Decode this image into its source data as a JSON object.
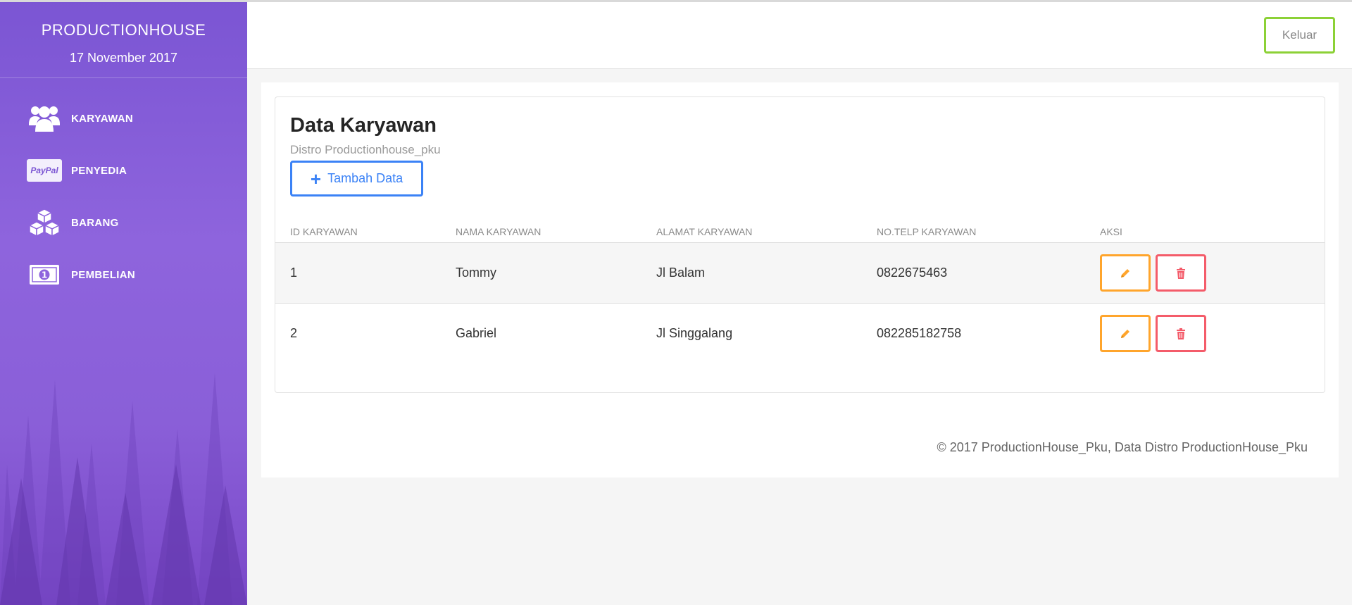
{
  "sidebar": {
    "brand_name": "PRODUCTIONHOUSE",
    "date": "17 November 2017",
    "items": [
      {
        "label": "KARYAWAN",
        "icon": "users-icon"
      },
      {
        "label": "PENYEDIA",
        "icon": "paypal-icon",
        "badge_text": "PayPal"
      },
      {
        "label": "BARANG",
        "icon": "boxes-icon"
      },
      {
        "label": "PEMBELIAN",
        "icon": "money-icon"
      }
    ],
    "colors": {
      "gradient_top": "#7b55d3",
      "gradient_bottom": "#7a48c8"
    }
  },
  "header": {
    "logout_label": "Keluar",
    "logout_color": "#8cd136"
  },
  "main": {
    "title": "Data Karyawan",
    "subtitle": "Distro Productionhouse_pku",
    "add_button_label": "Tambah Data",
    "add_button_icon": "plus-icon",
    "table": {
      "columns": [
        "ID KARYAWAN",
        "NAMA KARYAWAN",
        "ALAMAT KARYAWAN",
        "NO.TELP KARYAWAN",
        "AKSI"
      ],
      "rows": [
        {
          "id": "1",
          "name": "Tommy",
          "address": "Jl Balam",
          "phone": "0822675463"
        },
        {
          "id": "2",
          "name": "Gabriel",
          "address": "Jl Singgalang",
          "phone": "082285182758"
        }
      ],
      "actions": [
        {
          "name": "edit",
          "icon": "pencil-icon",
          "color": "#ffa52c"
        },
        {
          "name": "delete",
          "icon": "trash-icon",
          "color": "#f45c6a"
        }
      ]
    },
    "footer": "© 2017 ProductionHouse_Pku, Data Distro ProductionHouse_Pku"
  }
}
